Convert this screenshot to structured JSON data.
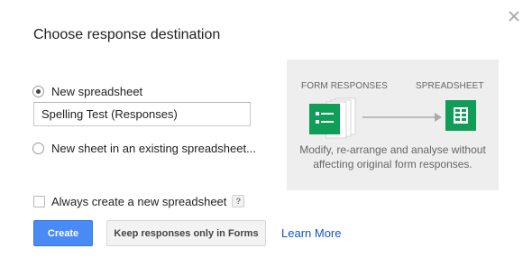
{
  "dialog": {
    "title": "Choose response destination",
    "close_icon": "close-icon"
  },
  "options": {
    "new_spreadsheet": {
      "label": "New spreadsheet",
      "selected": true
    },
    "spreadsheet_name": {
      "value": "Spelling Test (Responses)"
    },
    "existing_spreadsheet": {
      "label": "New sheet in an existing spreadsheet...",
      "selected": false
    }
  },
  "illustration": {
    "form_heading": "FORM RESPONSES",
    "sheet_heading": "SPREADSHEET",
    "description_line1": "Modify, re-arrange and analyse without",
    "description_line2": "affecting original form responses.",
    "form_icon": "form-responses-icon",
    "sheet_icon": "spreadsheet-icon",
    "arrow_icon": "arrow-right-icon"
  },
  "always_create": {
    "label": "Always create a new spreadsheet",
    "checked": false,
    "help": "?"
  },
  "buttons": {
    "create": "Create",
    "keep": "Keep responses only in Forms",
    "learn_more": "Learn More"
  },
  "colors": {
    "primary_button": "#4a8af4",
    "sheets_green": "#0f9d58",
    "link": "#1155cc"
  }
}
